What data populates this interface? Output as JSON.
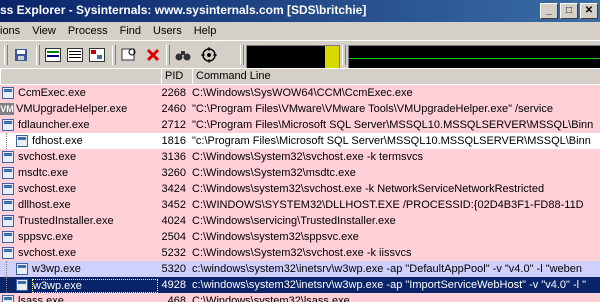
{
  "window": {
    "title": "ss Explorer - Sysinternals: www.sysinternals.com [SDS\\britchie]",
    "buttons": {
      "minimize": "_",
      "maximize": "□",
      "close": "✕"
    }
  },
  "menu": [
    "ions",
    "View",
    "Process",
    "Find",
    "Users",
    "Help"
  ],
  "toolbar": {
    "icons": [
      "save-icon",
      "system-info-icon",
      "refresh-icon",
      "tree-icon",
      "find-window-icon",
      "kill-process-icon",
      "find-icon",
      "target-icon"
    ],
    "graph_values": {
      "cpu": 0.15,
      "memory": 0.45
    },
    "colors": {
      "cpu_fill": "#d8d800",
      "memory_line": "#00c000"
    }
  },
  "columns": {
    "process": "",
    "pid": "PID",
    "command_line": "Command Line"
  },
  "processes": [
    {
      "name": "CcmExec.exe",
      "pid": "2268",
      "cmd": "C:\\Windows\\SysWOW64\\CCM\\CcmExec.exe",
      "style": "svc",
      "indent": 0
    },
    {
      "name": "VMUpgradeHelper.exe",
      "pid": "2460",
      "cmd": "\"C:\\Program Files\\VMware\\VMware Tools\\VMUpgradeHelper.exe\" /service",
      "style": "svc",
      "indent": 0,
      "badge": "VM"
    },
    {
      "name": "fdlauncher.exe",
      "pid": "2712",
      "cmd": "\"C:\\Program Files\\Microsoft SQL Server\\MSSQL10.MSSQLSERVER\\MSSQL\\Binn",
      "style": "svc",
      "indent": 0
    },
    {
      "name": "fdhost.exe",
      "pid": "1816",
      "cmd": "\"c:\\Program Files\\Microsoft SQL Server\\MSSQL10.MSSQLSERVER\\MSSQL\\Binn",
      "style": "plain",
      "indent": 1
    },
    {
      "name": "svchost.exe",
      "pid": "3136",
      "cmd": "C:\\Windows\\System32\\svchost.exe -k termsvcs",
      "style": "svc",
      "indent": 0
    },
    {
      "name": "msdtc.exe",
      "pid": "3260",
      "cmd": "C:\\Windows\\System32\\msdtc.exe",
      "style": "svc",
      "indent": 0
    },
    {
      "name": "svchost.exe",
      "pid": "3424",
      "cmd": "C:\\Windows\\system32\\svchost.exe -k NetworkServiceNetworkRestricted",
      "style": "svc",
      "indent": 0
    },
    {
      "name": "dllhost.exe",
      "pid": "3452",
      "cmd": "C:\\WINDOWS\\SYSTEM32\\DLLHOST.EXE /PROCESSID:{02D4B3F1-FD88-11D",
      "style": "svc",
      "indent": 0
    },
    {
      "name": "TrustedInstaller.exe",
      "pid": "4024",
      "cmd": "C:\\Windows\\servicing\\TrustedInstaller.exe",
      "style": "svc",
      "indent": 0
    },
    {
      "name": "sppsvc.exe",
      "pid": "2504",
      "cmd": "C:\\Windows\\system32\\sppsvc.exe",
      "style": "svc",
      "indent": 0
    },
    {
      "name": "svchost.exe",
      "pid": "5232",
      "cmd": "C:\\Windows\\System32\\svchost.exe -k iissvcs",
      "style": "svc",
      "indent": 0
    },
    {
      "name": "w3wp.exe",
      "pid": "5320",
      "cmd": "c:\\windows\\system32\\inetsrv\\w3wp.exe -ap \"DefaultAppPool\" -v \"v4.0\" -l \"weben",
      "style": "self",
      "indent": 1
    },
    {
      "name": "w3wp.exe",
      "pid": "4928",
      "cmd": "c:\\windows\\system32\\inetsrv\\w3wp.exe -ap \"ImportServiceWebHost\" -v \"v4.0\" -l \"",
      "style": "selected",
      "indent": 1
    },
    {
      "name": "lsass.exe",
      "pid": "468",
      "cmd": "C:\\Windows\\system32\\lsass.exe",
      "style": "svc",
      "indent": 0
    }
  ]
}
